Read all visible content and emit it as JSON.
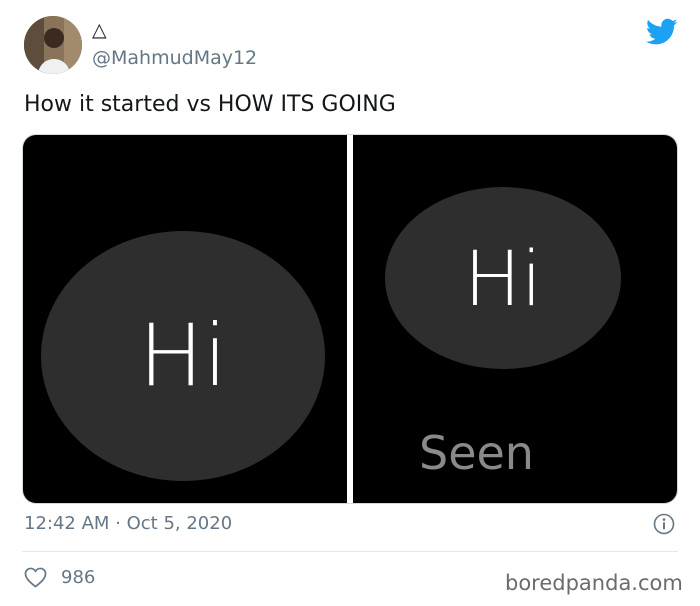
{
  "tweet": {
    "display_name": "△",
    "handle": "@MahmudMay12",
    "text": "How it started vs HOW ITS GOING",
    "timestamp": "12:42 AM · Oct 5, 2020",
    "likes": "986"
  },
  "media": {
    "left_bubble_text": "Hi",
    "right_bubble_text": "Hi",
    "right_status_text": "Seen"
  },
  "icons": {
    "brand": "twitter-bird-icon",
    "info": "info-icon",
    "like": "heart-icon"
  },
  "colors": {
    "brand": "#1da1f2",
    "secondary_text": "#657786",
    "bubble": "#2e2e2e",
    "panel_background": "#000000"
  },
  "watermark": "boredpanda.com"
}
